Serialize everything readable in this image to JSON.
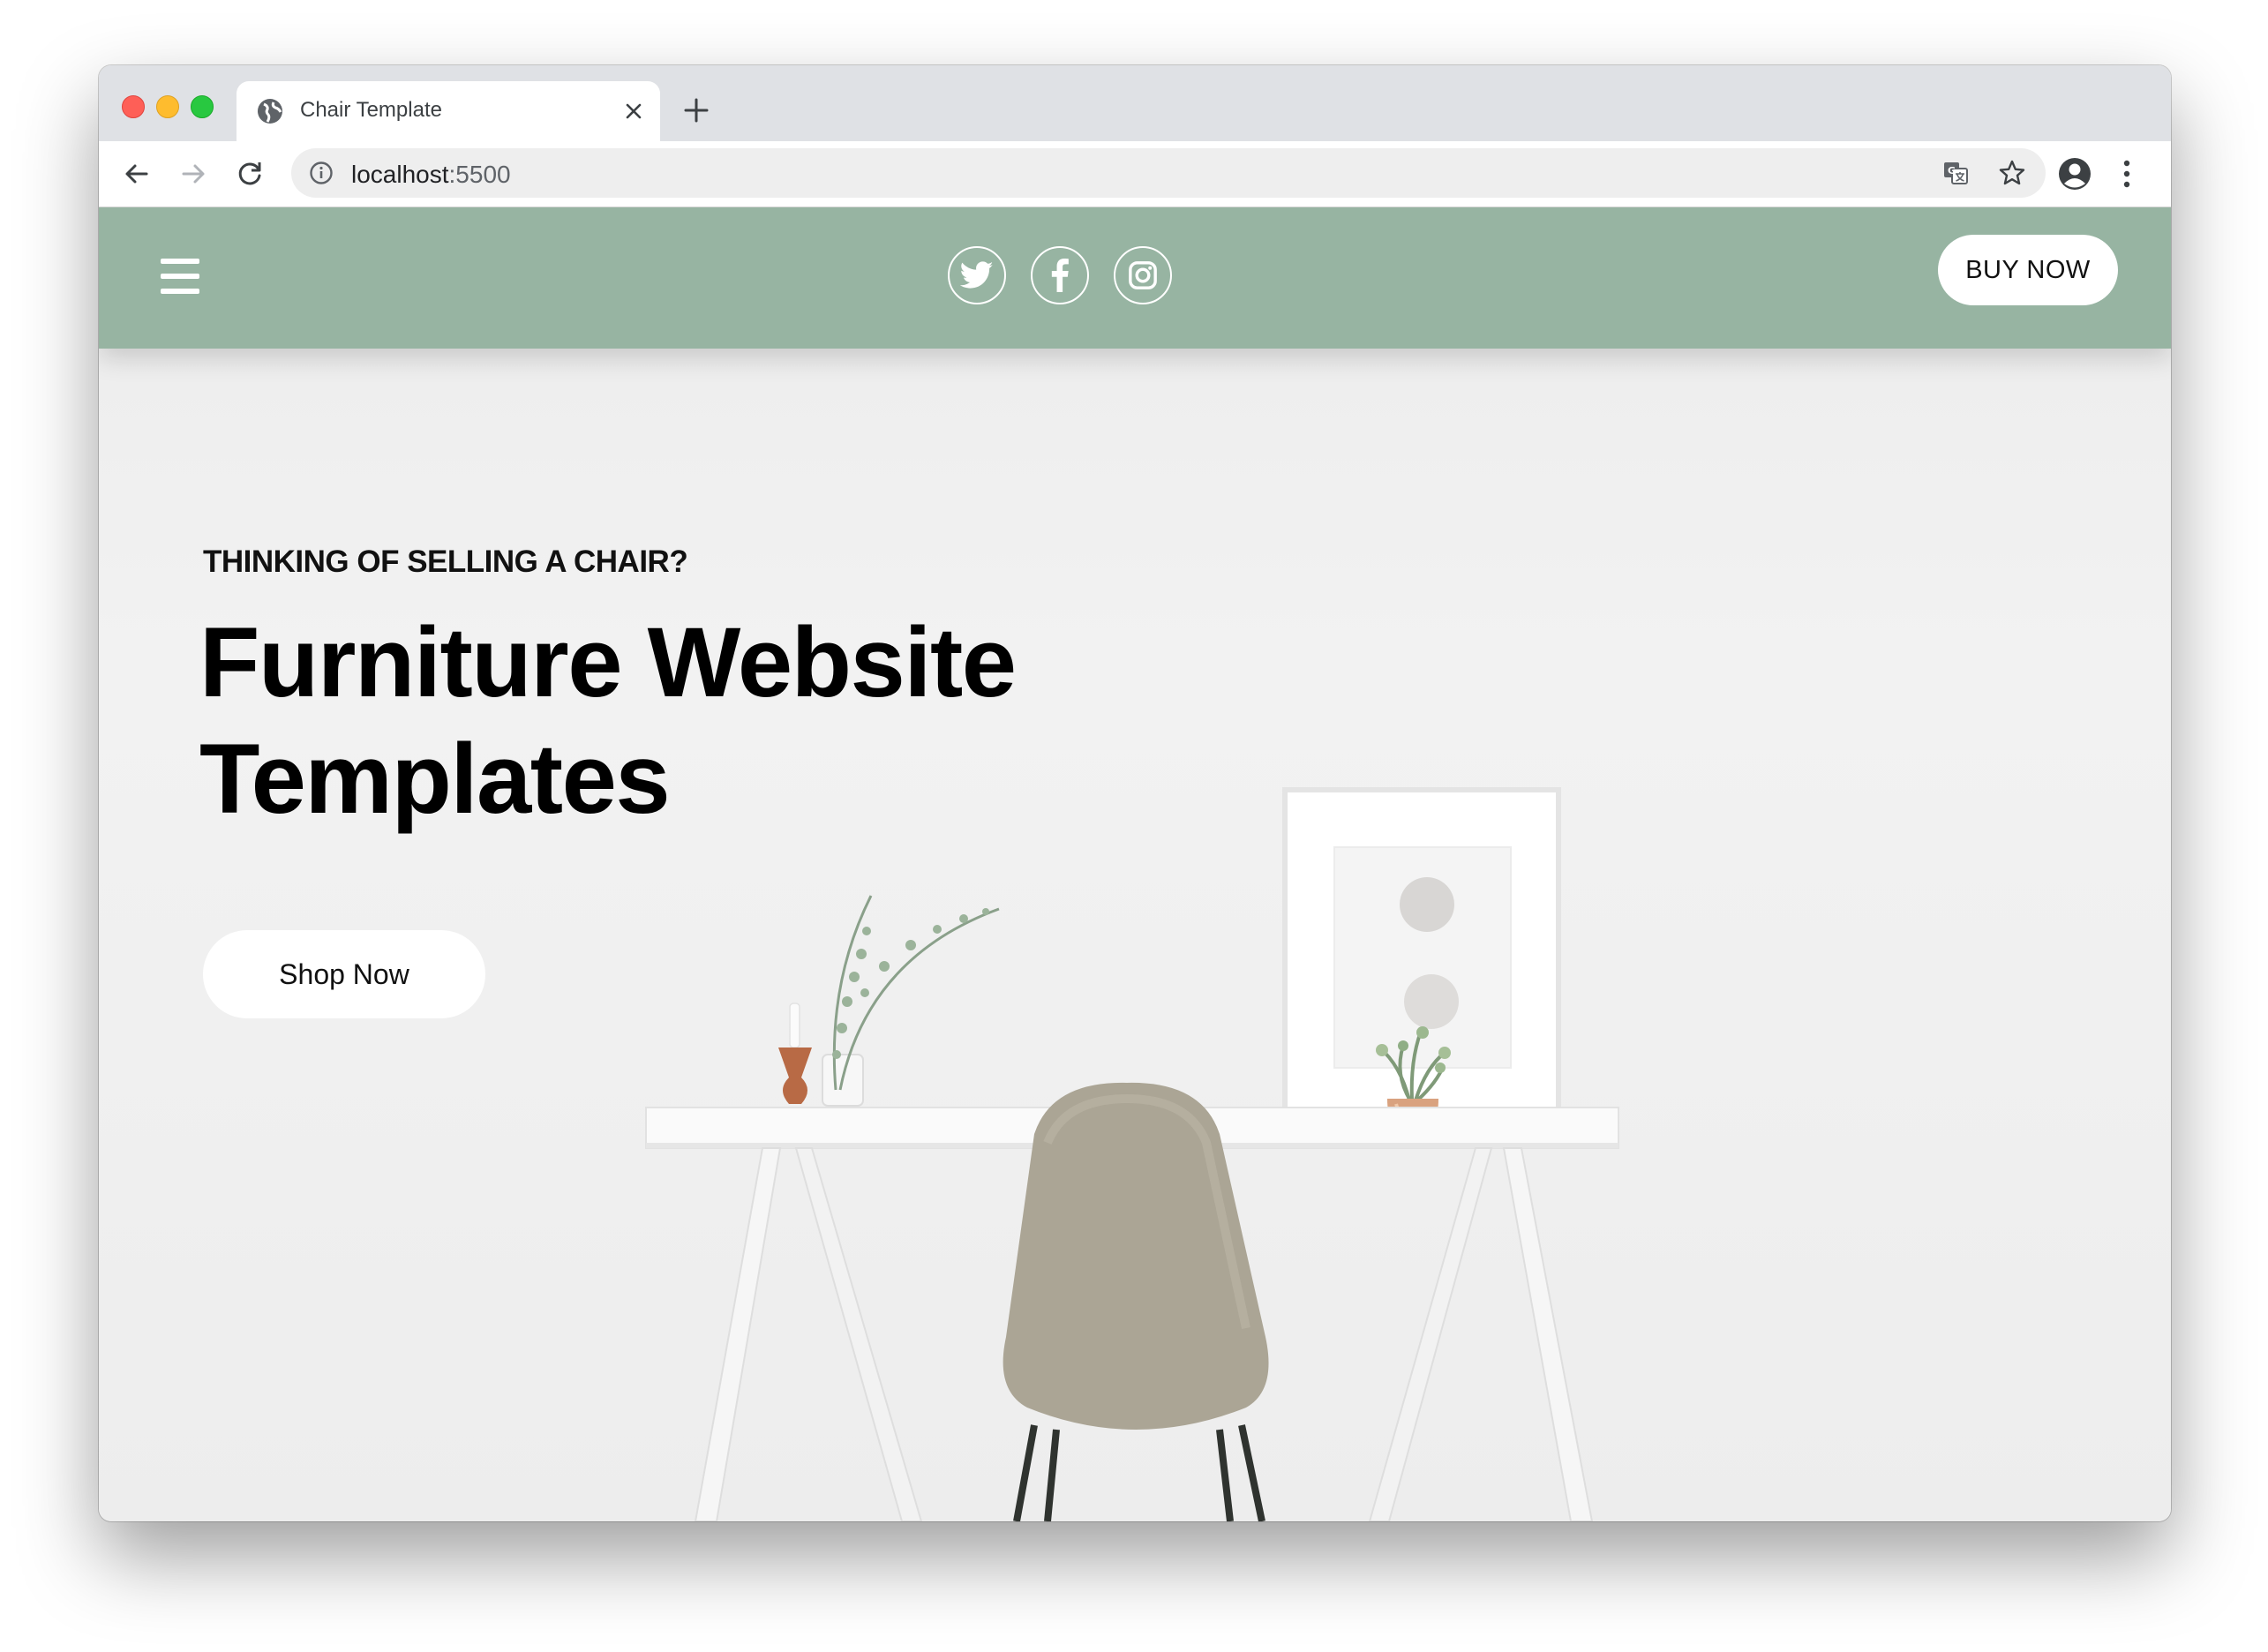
{
  "browser": {
    "tab_title": "Chair Template",
    "url_host": "localhost",
    "url_port": ":5500"
  },
  "site": {
    "header": {
      "buy_now_label": "BUY NOW",
      "social_icons": [
        "twitter-icon",
        "facebook-icon",
        "instagram-icon"
      ],
      "background_color": "#97b4a2"
    },
    "hero": {
      "eyebrow": "THINKING OF SELLING A CHAIR?",
      "title_line1": "Furniture Website",
      "title_line2": "Templates",
      "cta_label": "Shop Now"
    }
  }
}
